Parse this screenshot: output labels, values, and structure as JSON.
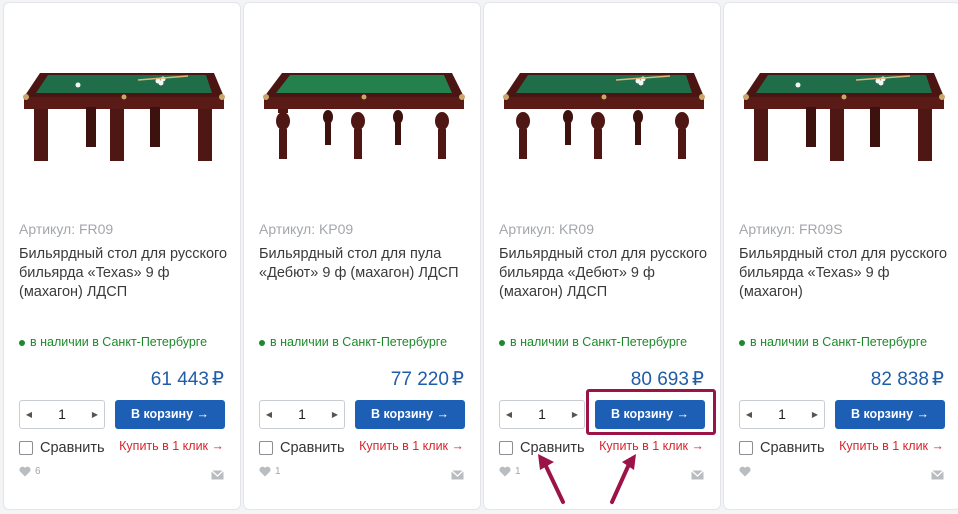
{
  "products": [
    {
      "sku": "Артикул: FR09",
      "title": "Бильярдный стол для русского бильярда «Texas» 9 ф (махагон) ЛДСП",
      "stock": "в наличии в Санкт-Петербурге",
      "price": "61 443",
      "currency": "₽",
      "qty": "1",
      "cart_label": "В корзину →",
      "compare_label": "Сравнить",
      "oneclick_label": "Купить в 1 клик →",
      "likes": "6",
      "image_style": "square-legs"
    },
    {
      "sku": "Артикул: KP09",
      "title": "Бильярдный стол для пула «Дебют» 9 ф (махагон) ЛДСП",
      "stock": "в наличии в Санкт-Петербурге",
      "price": "77 220",
      "currency": "₽",
      "qty": "1",
      "cart_label": "В корзину →",
      "compare_label": "Сравнить",
      "oneclick_label": "Купить в 1 клик →",
      "likes": "1",
      "image_style": "turned-legs"
    },
    {
      "sku": "Артикул: KR09",
      "title": "Бильярдный стол для русского бильярда «Дебют» 9 ф (махагон) ЛДСП",
      "stock": "в наличии в Санкт-Петербурге",
      "price": "80 693",
      "currency": "₽",
      "qty": "1",
      "cart_label": "В корзину →",
      "compare_label": "Сравнить",
      "oneclick_label": "Купить в 1 клик →",
      "likes": "1",
      "image_style": "turned-legs"
    },
    {
      "sku": "Артикул: FR09S",
      "title": "Бильярдный стол для русского бильярда «Texas» 9 ф (махагон)",
      "stock": "в наличии в Санкт-Петербурге",
      "price": "82 838",
      "currency": "₽",
      "qty": "1",
      "cart_label": "В корзину →",
      "compare_label": "Сравнить",
      "oneclick_label": "Купить в 1 клик →",
      "likes": "",
      "image_style": "square-legs"
    }
  ],
  "colors": {
    "accent_blue": "#1d5fb5",
    "price_blue": "#1f5da8",
    "stock_green": "#1c8a2a",
    "oneclick_red": "#d6262f",
    "annotation": "#9c1347",
    "felt_green": "#1f6e49",
    "wood": "#5a1a16"
  },
  "icons": {
    "qty_decrease": "triangle-left-icon",
    "qty_increase": "triangle-right-icon",
    "likes": "heart-icon",
    "mail": "envelope-icon",
    "stock": "dot-icon"
  }
}
